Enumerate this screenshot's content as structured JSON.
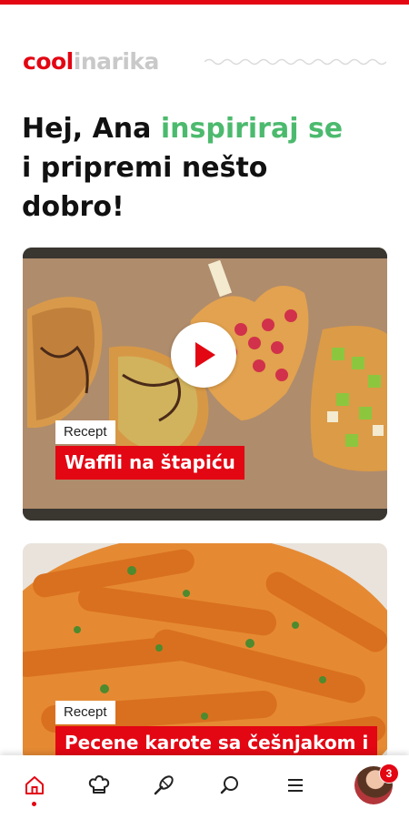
{
  "header": {
    "logo_part1": "cool",
    "logo_part2": "inarika",
    "greeting_line1_prefix": "Hej, Ana ",
    "greeting_line1_accent": "inspiriraj se",
    "greeting_line2": "i pripremi nešto",
    "greeting_line3": "dobro!"
  },
  "cards": [
    {
      "tag": "Recept",
      "title": "Waffli na štapiću",
      "has_video": true
    },
    {
      "tag": "Recept",
      "title": "Pecene karote sa češnjakom i",
      "has_video": false
    }
  ],
  "bottom_nav": {
    "items": [
      {
        "name": "home",
        "icon": "home-icon",
        "active": true
      },
      {
        "name": "recipes",
        "icon": "chef-hat-icon",
        "active": false
      },
      {
        "name": "cooking",
        "icon": "whisk-icon",
        "active": false
      },
      {
        "name": "search",
        "icon": "search-icon",
        "active": false
      },
      {
        "name": "menu",
        "icon": "menu-icon",
        "active": false
      }
    ],
    "notification_count": "3"
  },
  "colors": {
    "brand_red": "#e30613",
    "accent_green": "#4cba6e"
  }
}
